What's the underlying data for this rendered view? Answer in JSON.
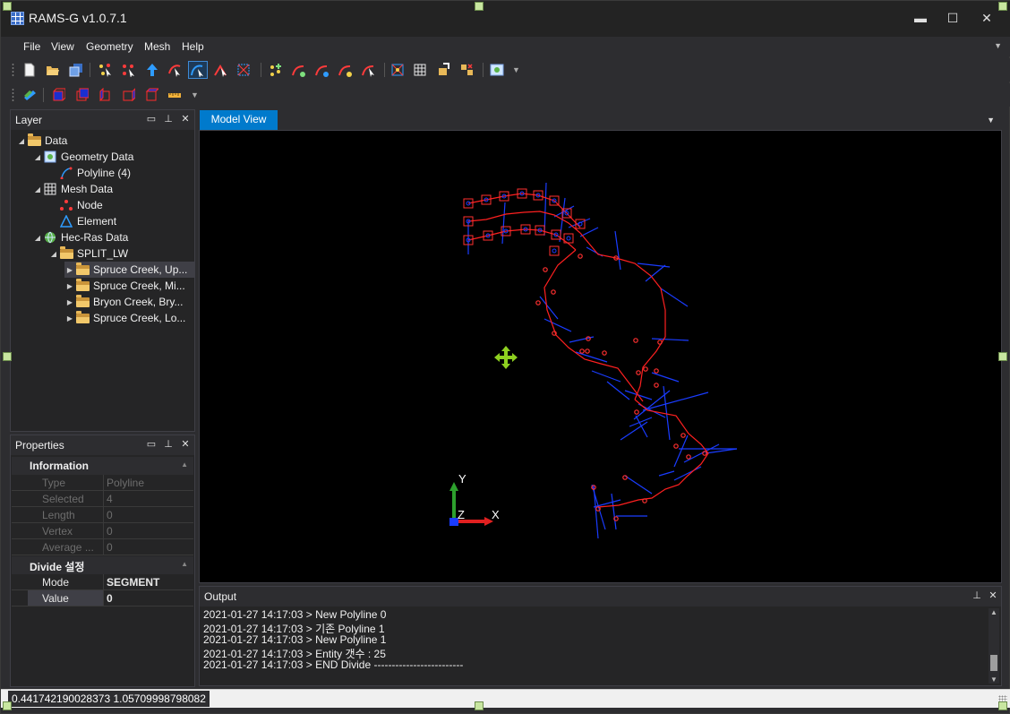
{
  "app": {
    "title": "RAMS-G v1.0.7.1"
  },
  "window_controls": {
    "minimize": "▬",
    "maximize": "☐",
    "close": "✕"
  },
  "menu": {
    "items": [
      "File",
      "View",
      "Geometry",
      "Mesh",
      "Help"
    ]
  },
  "toolbar1": {
    "buttons": [
      "new-file",
      "open-folder",
      "save",
      "select-nodes",
      "move-node",
      "add-arrow",
      "pick-point",
      "draw-polyline",
      "split-polyline",
      "mesh-select",
      "add-node",
      "line-tool-1",
      "line-tool-2",
      "line-tool-3",
      "line-tool-4",
      "mesh-tool-1",
      "mesh-grid",
      "rotate-tool",
      "export-tool",
      "settings-tool"
    ],
    "active_button": "draw-polyline"
  },
  "toolbar2": {
    "buttons": [
      "layer-tool",
      "view-front",
      "view-back",
      "view-left",
      "view-right",
      "view-top",
      "ruler-tool"
    ]
  },
  "layer_panel": {
    "title": "Layer",
    "tree": [
      {
        "label": "Data",
        "level": 0,
        "expanded": true,
        "icon": "folder-open-icon"
      },
      {
        "label": "Geometry Data",
        "level": 1,
        "expanded": true,
        "icon": "geometry-icon"
      },
      {
        "label": "Polyline (4)",
        "level": 2,
        "icon": "polyline-icon"
      },
      {
        "label": "Mesh Data",
        "level": 1,
        "expanded": true,
        "icon": "mesh-icon"
      },
      {
        "label": "Node",
        "level": 2,
        "icon": "node-icon"
      },
      {
        "label": "Element",
        "level": 2,
        "icon": "element-icon"
      },
      {
        "label": "Hec-Ras Data",
        "level": 1,
        "expanded": true,
        "icon": "globe-icon"
      },
      {
        "label": "SPLIT_LW",
        "level": 2,
        "expanded": true,
        "icon": "folder-open-icon"
      },
      {
        "label": "Spruce Creek, Up...",
        "level": 3,
        "collapsed": true,
        "icon": "folder-open-icon",
        "selected": true
      },
      {
        "label": "Spruce Creek, Mi...",
        "level": 3,
        "collapsed": true,
        "icon": "folder-open-icon"
      },
      {
        "label": "Bryon Creek, Bry...",
        "level": 3,
        "collapsed": true,
        "icon": "folder-open-icon"
      },
      {
        "label": "Spruce Creek, Lo...",
        "level": 3,
        "collapsed": true,
        "icon": "folder-open-icon"
      }
    ]
  },
  "properties_panel": {
    "title": "Properties",
    "information": {
      "label": "Information",
      "rows": [
        {
          "name": "Type",
          "value": "Polyline"
        },
        {
          "name": "Selected",
          "value": "4"
        },
        {
          "name": "Length",
          "value": "0"
        },
        {
          "name": "Vertex",
          "value": "0"
        },
        {
          "name": "Average ...",
          "value": "0"
        }
      ]
    },
    "divide": {
      "label": "Divide 설정",
      "rows": [
        {
          "name": "Mode",
          "value": "SEGMENT"
        },
        {
          "name": "Value",
          "value": "0"
        }
      ]
    }
  },
  "model_view": {
    "tab_label": "Model View",
    "axis": {
      "x_label": "X",
      "y_label": "Y",
      "z_label": "Z"
    },
    "colors": {
      "polyline": "#ff2020",
      "cross_section": "#1a3cff",
      "node": "#ff3030",
      "pan_cursor": "#8ed020"
    }
  },
  "output_panel": {
    "title": "Output",
    "lines": [
      "2021-01-27 14:17:03 > New Polyline 0",
      "2021-01-27 14:17:03 > 기존 Polyline 1",
      "2021-01-27 14:17:03 > New Polyline 1",
      "2021-01-27 14:17:03 > Entity 갯수 : 25",
      "2021-01-27 14:17:03 > END Divide -------------------------"
    ]
  },
  "status_bar": {
    "coordinates": "0.441742190028373 1.05709998798082"
  }
}
